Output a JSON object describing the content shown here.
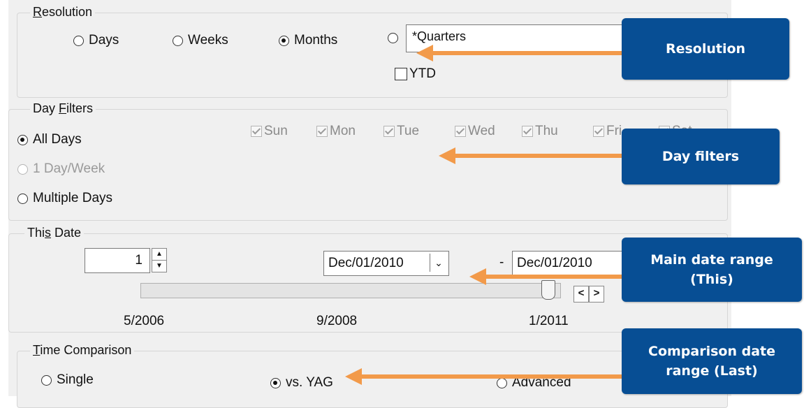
{
  "resolution": {
    "title": "Resolution",
    "options": [
      "Days",
      "Weeks",
      "Months"
    ],
    "quarters_value": "*Quarters",
    "ytd_label": "YTD"
  },
  "day_filters": {
    "title": "Day Filters",
    "modes": [
      "All Days",
      "1 Day/Week",
      "Multiple Days"
    ],
    "days": [
      "Sun",
      "Mon",
      "Tue",
      "Wed",
      "Thu",
      "Fri",
      "Sat"
    ]
  },
  "this_date": {
    "title": "This Date",
    "spinner_value": "1",
    "start_date": "Dec/01/2010",
    "dash": "-",
    "end_date": "Dec/01/2010",
    "prev_label": "<",
    "next_label": ">",
    "ticks": [
      "5/2006",
      "9/2008",
      "1/2011"
    ]
  },
  "time_comparison": {
    "title": "Time Comparison",
    "options": [
      "Single",
      "vs. YAG",
      "Advanced"
    ]
  },
  "callouts": {
    "resolution": "Resolution",
    "day_filters": "Day filters",
    "main_date_range": "Main date range (This)",
    "comparison": "Comparison date range (Last)"
  },
  "colors": {
    "callout_bg": "#074e94",
    "arrow": "#f29a4a"
  }
}
